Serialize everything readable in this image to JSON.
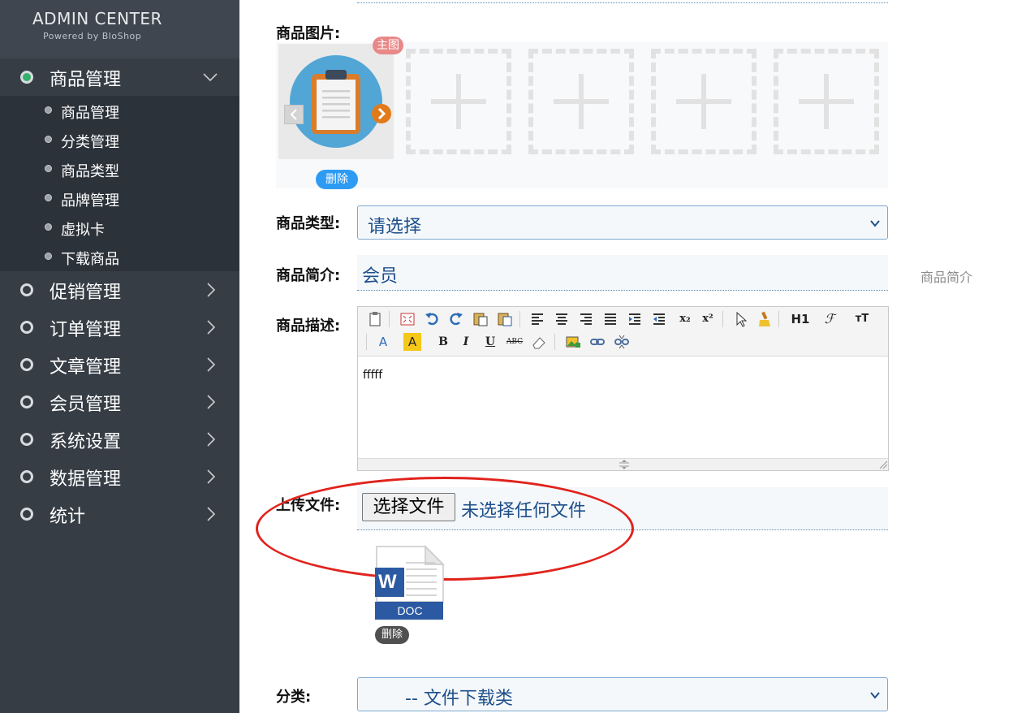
{
  "sidebar": {
    "brand_title": "ADMIN CENTER",
    "brand_sub": "Powered by BloShop",
    "active_color": "#35b06a",
    "groups": [
      {
        "label": "商品管理",
        "expanded": true
      },
      {
        "label": "促销管理"
      },
      {
        "label": "订单管理"
      },
      {
        "label": "文章管理"
      },
      {
        "label": "会员管理"
      },
      {
        "label": "系统设置"
      },
      {
        "label": "数据管理"
      },
      {
        "label": "统计"
      }
    ],
    "sub_items": [
      "商品管理",
      "分类管理",
      "商品类型",
      "品牌管理",
      "虚拟卡",
      "下载商品"
    ]
  },
  "form": {
    "picture": {
      "label": "商品图片:",
      "main_tag": "主图",
      "delete": "删除",
      "empty_slots": 4
    },
    "type": {
      "label": "商品类型:",
      "value": "请选择"
    },
    "intro": {
      "label": "商品简介:",
      "value": "会员",
      "hint": "商品简介"
    },
    "description": {
      "label": "商品描述:",
      "content": "fffff",
      "toolbar": [
        "paste-icon",
        "fullscreen-icon",
        "undo-icon",
        "redo-icon",
        "paste-text-icon",
        "paste-word-icon",
        "align-left-icon",
        "align-center-icon",
        "align-right-icon",
        "justify-icon",
        "indent-icon",
        "outdent-icon",
        "subscript-icon",
        "superscript-icon",
        "select-icon",
        "clear-format-icon",
        "heading-icon",
        "font-family-icon",
        "font-size-icon",
        "font-color-icon",
        "bg-color-icon",
        "bold-icon",
        "italic-icon",
        "underline-icon",
        "strikethrough-icon",
        "eraser-icon",
        "image-icon",
        "link-icon",
        "unlink-icon"
      ],
      "toolbar_text": {
        "h1": "H1",
        "sub": "x₂",
        "sup": "x²",
        "bold": "B",
        "italic": "I",
        "underline": "U",
        "strike": "ABC",
        "font_color": "A",
        "bg_color": "A",
        "size": "тT"
      }
    },
    "upload": {
      "label": "上传文件:",
      "button": "选择文件",
      "status": "未选择任何文件",
      "file_type": "DOC",
      "file_badge": "W",
      "delete": "删除"
    },
    "category": {
      "label": "分类:",
      "value": "-- 文件下载类"
    }
  }
}
